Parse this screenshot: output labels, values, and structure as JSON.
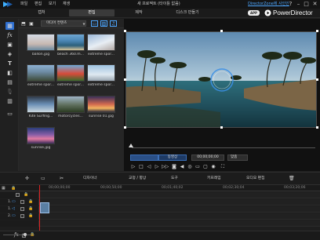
{
  "titlebar": {
    "menu": [
      "파일",
      "편집",
      "보기",
      "재생"
    ],
    "doc_title": "새 프로젝트 (타이틀 없음)",
    "signin": "DirectorZone에 사인인",
    "controls": {
      "help": "?",
      "minimize": "–",
      "maximize": "□",
      "close": "✕"
    }
  },
  "modes": {
    "capture": "캡처",
    "edit": "편집",
    "produce": "제작",
    "disc": "디스크 만들기"
  },
  "brand": {
    "badge": "APP",
    "name": "PowerDirector"
  },
  "library": {
    "dropdown": "미디어 컨텐츠",
    "items": [
      {
        "name": "ballon.jpg",
        "thumb": "linear-gradient(180deg,#d5dbe6 0%,#c9b9b2 60%,#6b8aa1 100%)"
      },
      {
        "name": "beach 360.m...",
        "thumb": "linear-gradient(180deg,#6ea6d2 0%,#4b86b4 40%,#2c5f7b 70%,#d7c49a 100%)"
      },
      {
        "name": "extreme spor...",
        "thumb": "linear-gradient(160deg,#9bb9d9 0%,#e8eef4 55%,#b0a6a2 100%)"
      },
      {
        "name": "extreme spor...",
        "thumb": "linear-gradient(180deg,#8db1d3 0%,#6d8aa2 45%,#3d4a38 100%)"
      },
      {
        "name": "extreme spor...",
        "thumb": "linear-gradient(180deg,#6ea9d6 0%,#d84b3a 55%,#3a6b2c 100%)"
      },
      {
        "name": "extreme spor...",
        "thumb": "linear-gradient(180deg,#9ec3e0 0%,#dfe9f1 60%,#9aa6b1 100%)"
      },
      {
        "name": "Kite Surfing...",
        "thumb": "linear-gradient(180deg,#2f3a4a 0%,#6b8fb5 50%,#cbd8df 100%)"
      },
      {
        "name": "motorcycles...",
        "thumb": "linear-gradient(180deg,#9fb4c6 0%,#5e6e5c 55%,#2b3b22 100%)"
      },
      {
        "name": "sunrise 01.jpg",
        "thumb": "linear-gradient(180deg,#3c2f5a 0%,#d46a4f 50%,#f2b360 75%,#2a2a3a 100%)"
      },
      {
        "name": "sunrise.jpg",
        "thumb": "linear-gradient(180deg,#2a3c7a 0%,#8a5fa8 45%,#e37ba3 70%,#3a2d5a 100%)"
      }
    ]
  },
  "player": {
    "time_mode": "동영상",
    "timecode": "00;00;00;00",
    "fit": "맞춤"
  },
  "timeline_toolbar": {
    "designer": "디자이너",
    "fix_enhance": "교정 / 향상",
    "tools": "도구",
    "keyframe": "키프레임",
    "audio_edit": "오디오 편집"
  },
  "ruler": [
    "00;00;00;00",
    "00;00;50;00",
    "00;01;40;02",
    "00;02;30;04",
    "00;03;20;06"
  ],
  "tracks": [
    {
      "num": "1."
    },
    {
      "num": "1."
    },
    {
      "num": "2."
    }
  ]
}
